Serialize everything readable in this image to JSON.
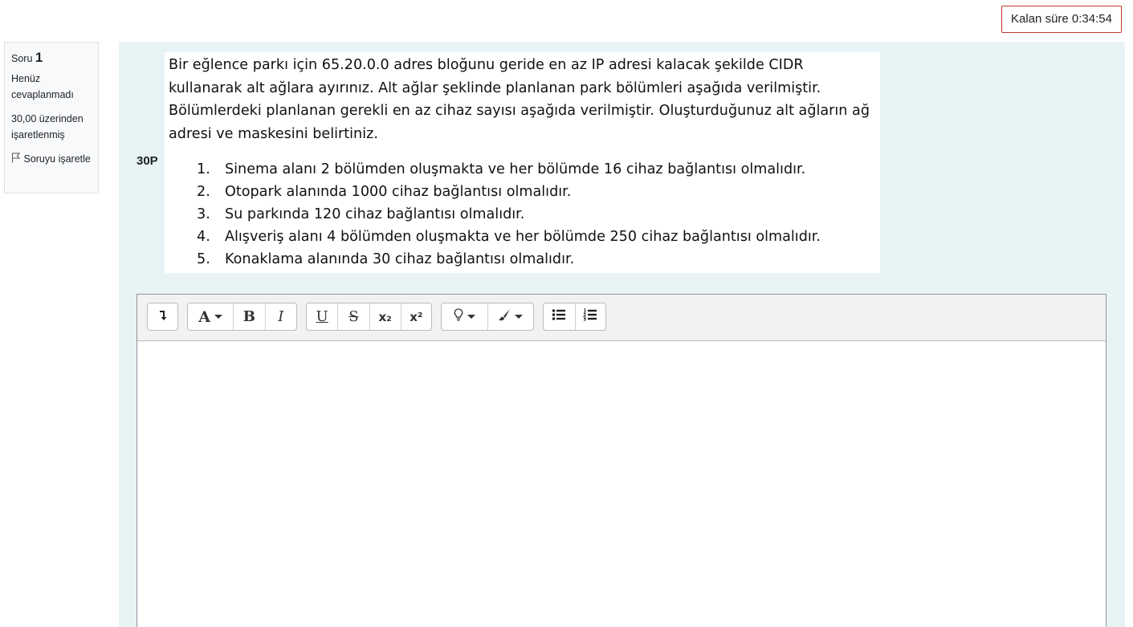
{
  "timer": {
    "label": "Kalan süre",
    "value": "0:34:54"
  },
  "question_info": {
    "soru_label": "Soru",
    "number": "1",
    "state": "Henüz cevaplanmadı",
    "grade": "30,00 üzerinden işaretlenmiş",
    "flag_label": "Soruyu işaretle"
  },
  "question": {
    "points_label": "30P",
    "intro": "Bir eğlence parkı için 65.20.0.0 adres bloğunu geride en az IP adresi kalacak şekilde CIDR kullanarak alt ağlara ayırınız. Alt ağlar şeklinde planlanan park bölümleri aşağıda verilmiştir. Bölümlerdeki planlanan gerekli en az cihaz sayısı aşağıda verilmiştir. Oluşturduğunuz alt ağların ağ adresi ve maskesini belirtiniz.",
    "items": [
      {
        "num": "1.",
        "text": "Sinema alanı 2 bölümden oluşmakta ve her bölümde 16 cihaz bağlantısı olmalıdır."
      },
      {
        "num": "2.",
        "text": "Otopark alanında 1000 cihaz bağlantısı olmalıdır."
      },
      {
        "num": "3.",
        "text": "Su parkında 120 cihaz bağlantısı olmalıdır."
      },
      {
        "num": "4.",
        "text": "Alışveriş alanı 4 bölümden oluşmakta ve her bölümde 250 cihaz bağlantısı olmalıdır."
      },
      {
        "num": "5.",
        "text": "Konaklama alanında 30 cihaz bağlantısı olmalıdır."
      }
    ]
  },
  "toolbar": {
    "toggle_icon": "show-more-icon",
    "font_icon": "font-style-icon",
    "font_glyph": "A",
    "bold": "B",
    "italic": "I",
    "underline": "U",
    "strike": "S",
    "subscript": "x₂",
    "superscript": "x²",
    "lightbulb_icon": "lightbulb-icon",
    "brush_icon": "paint-brush-icon",
    "bullet_list_icon": "unordered-list-icon",
    "number_list_icon": "ordered-list-icon"
  }
}
